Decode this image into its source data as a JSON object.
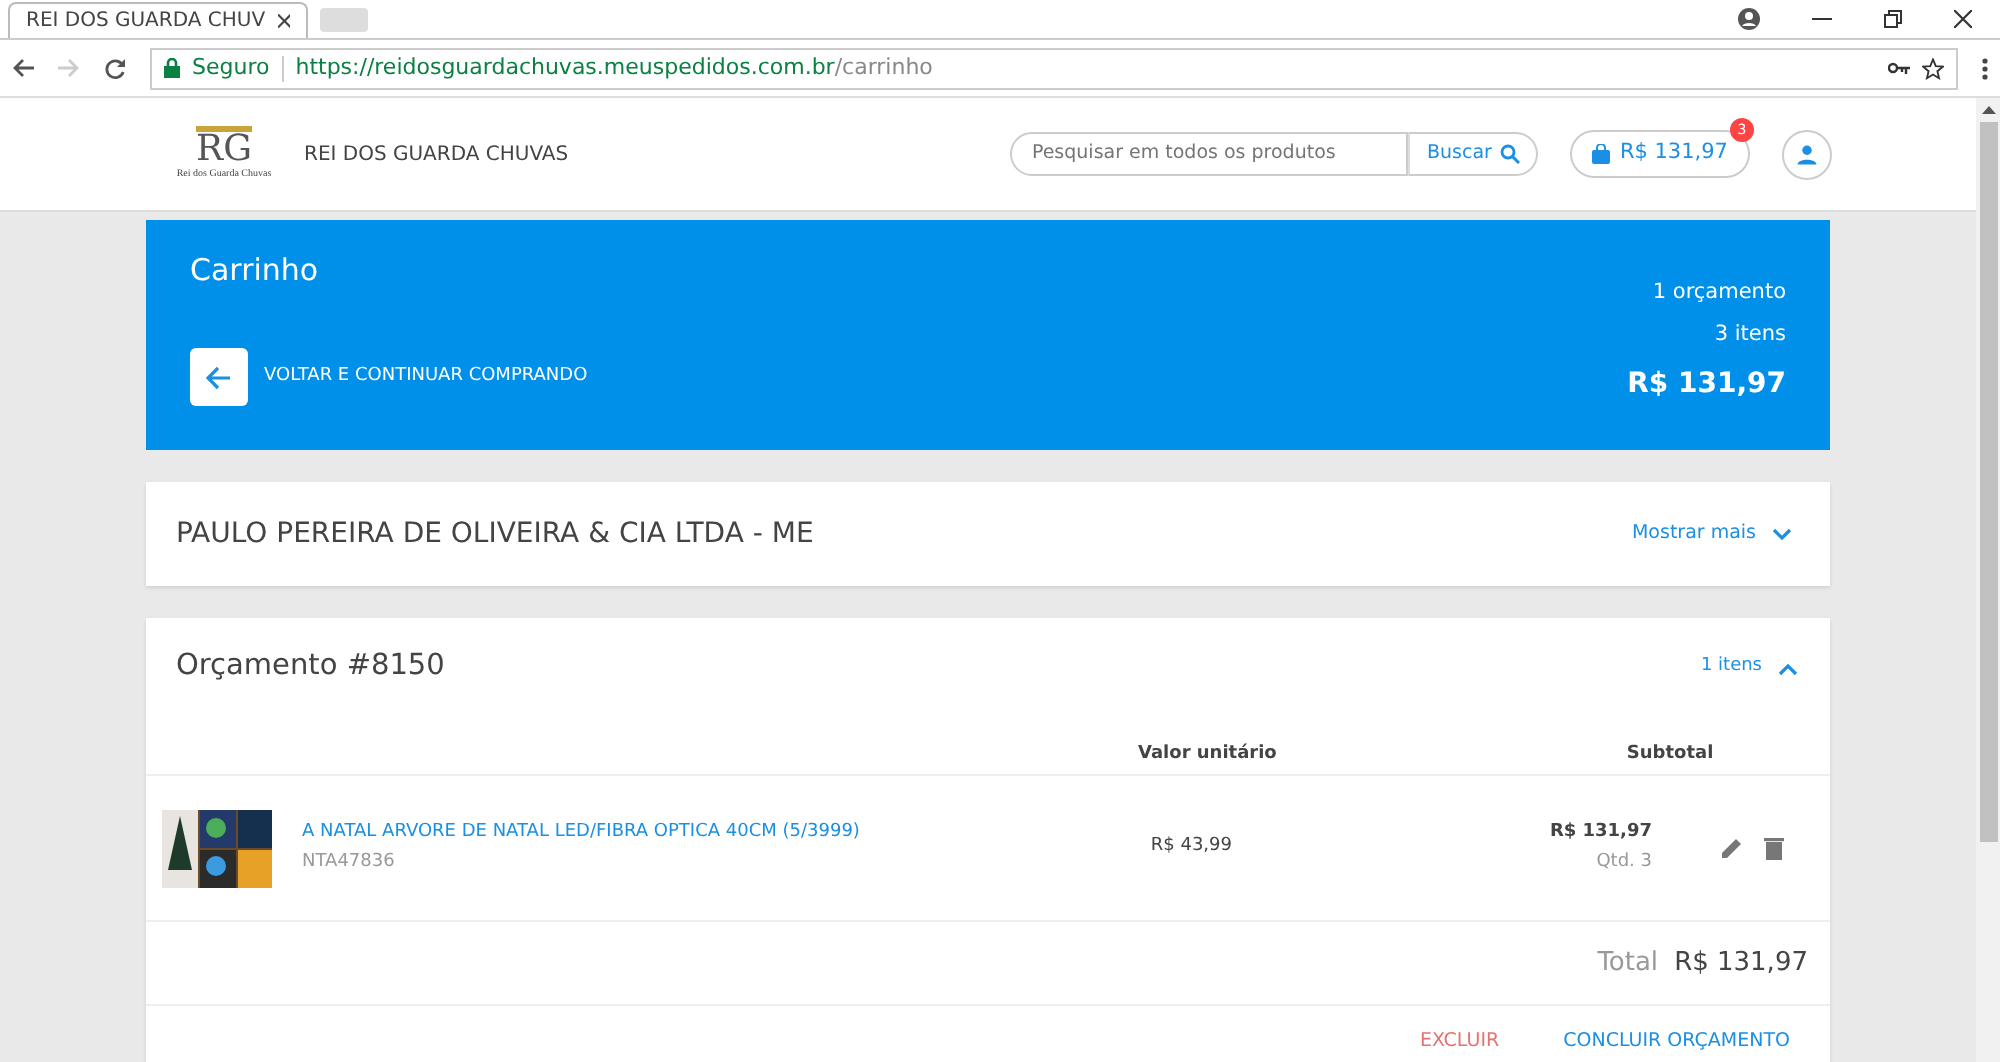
{
  "browser": {
    "tab_title": "REI DOS GUARDA CHUV",
    "secure_label": "Seguro",
    "url_base": "https://reidosguardachuvas.meuspedidos.com.br",
    "url_path": "/carrinho"
  },
  "header": {
    "logo_monogram": "RG",
    "logo_caption": "Rei dos Guarda Chuvas",
    "store_name": "REI DOS GUARDA CHUVAS",
    "search": {
      "placeholder": "Pesquisar em todos os produtos",
      "button": "Buscar"
    },
    "cart_total": "R$ 131,97",
    "cart_count": "3"
  },
  "banner": {
    "title": "Carrinho",
    "back_label": "VOLTAR E CONTINUAR COMPRANDO",
    "quotes": "1 orçamento",
    "items": "3 itens",
    "total": "R$ 131,97"
  },
  "company": {
    "name": "PAULO PEREIRA DE OLIVEIRA & CIA LTDA - ME",
    "toggle": "Mostrar mais",
    "expanded": false
  },
  "quote": {
    "title": "Orçamento #8150",
    "items_toggle": "1 itens",
    "expanded": true,
    "columns": [
      "Valor unitário",
      "Subtotal"
    ],
    "rows": [
      {
        "name": "A NATAL ARVORE DE NATAL LED/FIBRA OPTICA 40CM (5/3999)",
        "sku": "NTA47836",
        "unit_price": "R$ 43,99",
        "subtotal": "R$ 131,97",
        "qty": "Qtd. 3"
      }
    ],
    "total_label": "Total",
    "total": "R$ 131,97",
    "delete_label": "EXCLUIR",
    "confirm_label": "CONCLUIR ORÇAMENTO"
  }
}
